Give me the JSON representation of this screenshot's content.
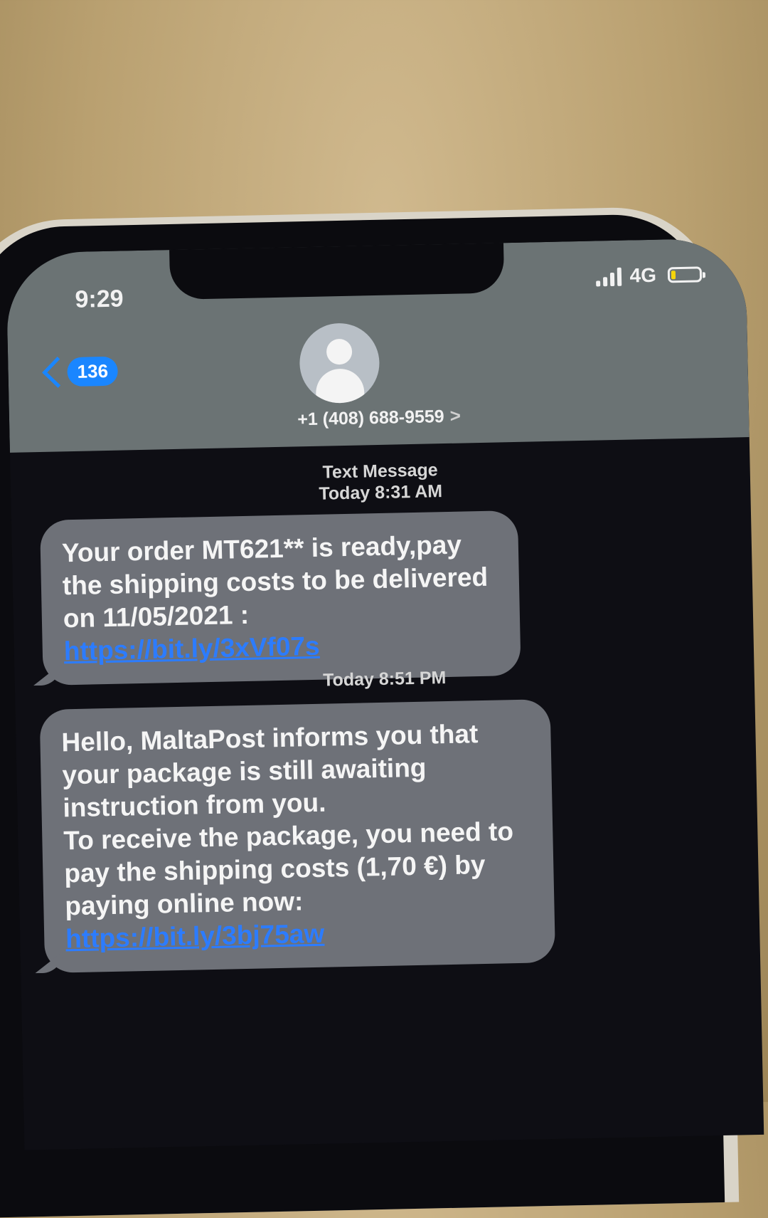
{
  "status_bar": {
    "time": "9:29",
    "network": "4G",
    "signal_icon": "signal-bars-icon",
    "battery_icon": "battery-low-icon"
  },
  "nav": {
    "back_icon": "chevron-left-icon",
    "unread_count": "136",
    "contact_icon": "person-avatar-icon",
    "contact_number": "+1 (408) 688-9559",
    "contact_chevron": ">"
  },
  "conversation": {
    "service_label": "Text Message",
    "messages": [
      {
        "timestamp": "Today 8:31 AM",
        "text": "Your order MT621** is ready,pay the shipping costs to be delivered on 11/05/2021 : ",
        "link": "https://bit.ly/3xVf07s"
      },
      {
        "timestamp": "Today 8:51 PM",
        "text_line1": "Hello, MaltaPost informs you that your package is still awaiting instruction from you.",
        "text_line2": "To receive the package, you need to pay the shipping costs (1,70 €) by paying online now: ",
        "link": "https://bit.ly/3bj75aw"
      }
    ]
  },
  "colors": {
    "accent": "#1a86ff",
    "bubble": "#6e7178",
    "header": "#6b7374",
    "link": "#2c7cff"
  }
}
